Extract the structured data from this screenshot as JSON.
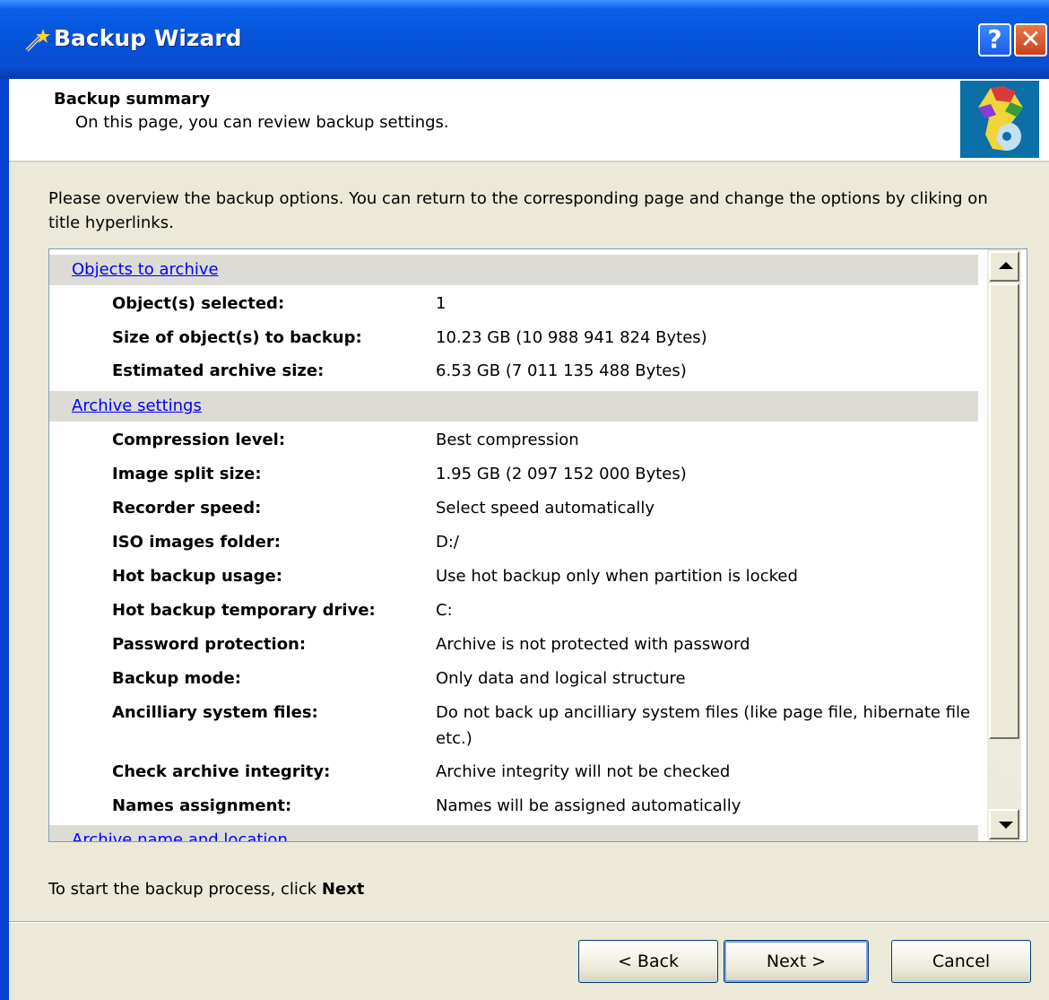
{
  "window": {
    "title": "Backup Wizard"
  },
  "header": {
    "title": "Backup summary",
    "subtitle": "On this page, you can review backup settings."
  },
  "intro": "Please overview the backup options. You can return to the corresponding page and change the options by cliking on title hyperlinks.",
  "sections": [
    {
      "title": "Objects to archive",
      "rows": [
        {
          "label": "Object(s) selected:",
          "value": "1"
        },
        {
          "label": "Size of object(s) to backup:",
          "value": "10.23 GB (10 988 941 824 Bytes)"
        },
        {
          "label": "Estimated archive size:",
          "value": "6.53 GB (7 011 135 488 Bytes)"
        }
      ]
    },
    {
      "title": "Archive settings",
      "rows": [
        {
          "label": "Compression level:",
          "value": "Best compression"
        },
        {
          "label": "Image split size:",
          "value": "1.95 GB (2 097 152 000 Bytes)"
        },
        {
          "label": "Recorder speed:",
          "value": "Select speed automatically"
        },
        {
          "label": "ISO images folder:",
          "value": "D:/"
        },
        {
          "label": "Hot backup usage:",
          "value": "Use hot backup only when partition is locked"
        },
        {
          "label": "Hot backup temporary drive:",
          "value": "C:"
        },
        {
          "label": "Password protection:",
          "value": "Archive is not protected with password"
        },
        {
          "label": "Backup mode:",
          "value": "Only data and logical structure"
        },
        {
          "label": "Ancilliary system files:",
          "value": "Do not back up ancilliary system files (like page file, hibernate file etc.)"
        },
        {
          "label": "Check archive integrity:",
          "value": "Archive integrity will not be checked"
        },
        {
          "label": "Names assignment:",
          "value": "Names will be assigned automatically"
        }
      ]
    },
    {
      "title": "Archive name and location",
      "rows": []
    }
  ],
  "footer": {
    "text_prefix": "To start the backup process, click ",
    "text_bold": "Next"
  },
  "buttons": {
    "back": "< Back",
    "next": "Next >",
    "cancel": "Cancel"
  },
  "icons": {
    "title": "wand-icon",
    "header": "backup-logo-icon",
    "help": "help-icon",
    "close": "close-icon"
  }
}
